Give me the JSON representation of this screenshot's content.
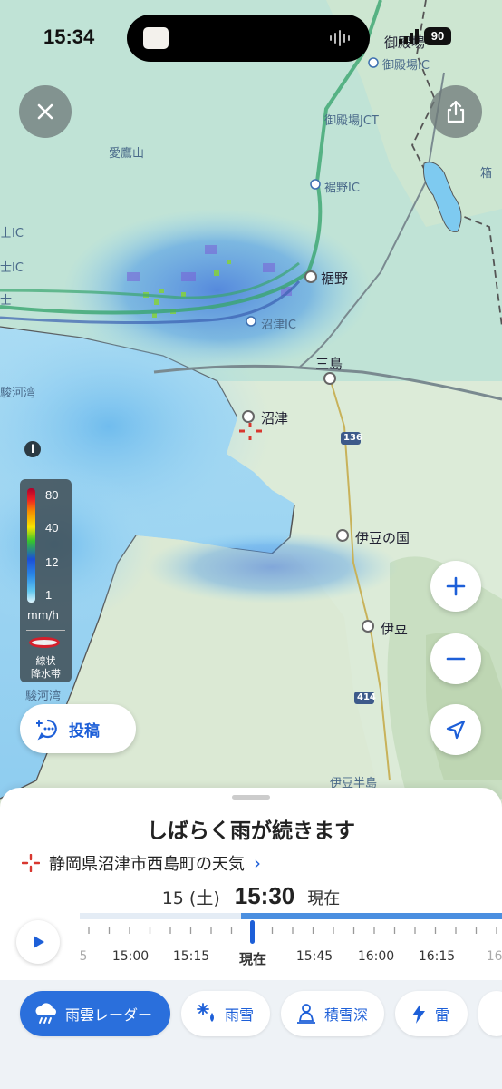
{
  "status_bar": {
    "time": "15:34",
    "battery": "90"
  },
  "map": {
    "labels": {
      "gotemba_road": "御殿場",
      "gotemba_ic": "御殿場IC",
      "gotemba_jct": "御殿場JCT",
      "aitakayama": "愛鷹山",
      "susono_ic": "裾野IC",
      "susono": "裾野",
      "numazu_ic": "沼津IC",
      "mishima": "三島",
      "numazu": "沼津",
      "surugawan_top": "駿河湾",
      "surugawan_bottom": "駿河湾",
      "izunokuni": "伊豆の国",
      "izu": "伊豆",
      "izuhanto": "伊豆半島",
      "fuji_frag": "士",
      "ic_frag1": "士IC",
      "ic_frag2": "士IC",
      "hako_frag": "箱",
      "route136": "136",
      "route414": "414"
    },
    "legend": {
      "values": [
        "80",
        "40",
        "12",
        "1"
      ],
      "unit": "mm/h",
      "band_line1": "線状",
      "band_line2": "降水帯"
    },
    "info_icon": "i",
    "post_label": "投稿",
    "colors": {
      "accent": "#1d5fd8",
      "sea": "#bfe3f4",
      "rain_light": "#6fc0ee",
      "rain_mid": "#2f6ee0",
      "rain_strong": "#7fd23a"
    }
  },
  "sheet": {
    "headline": "しばらく雨が続きます",
    "location": "静岡県沼津市西島町の天気",
    "date": "15 (土)",
    "current_time": "15:30",
    "now_label": "現在",
    "timeline_labels": [
      {
        "text": "5",
        "bold": false
      },
      {
        "text": "15:00",
        "bold": false
      },
      {
        "text": "15:15",
        "bold": false
      },
      {
        "text": "現在",
        "bold": true
      },
      {
        "text": "15:45",
        "bold": false
      },
      {
        "text": "16:00",
        "bold": false
      },
      {
        "text": "16:15",
        "bold": false
      },
      {
        "text": "16:",
        "bold": false
      }
    ]
  },
  "tabs": [
    {
      "label": "雨雲レーダー",
      "icon": "rain-cloud-icon",
      "active": true
    },
    {
      "label": "雨雪",
      "icon": "snow-rain-icon",
      "active": false
    },
    {
      "label": "積雪深",
      "icon": "snow-depth-icon",
      "active": false
    },
    {
      "label": "雷",
      "icon": "lightning-icon",
      "active": false
    }
  ]
}
